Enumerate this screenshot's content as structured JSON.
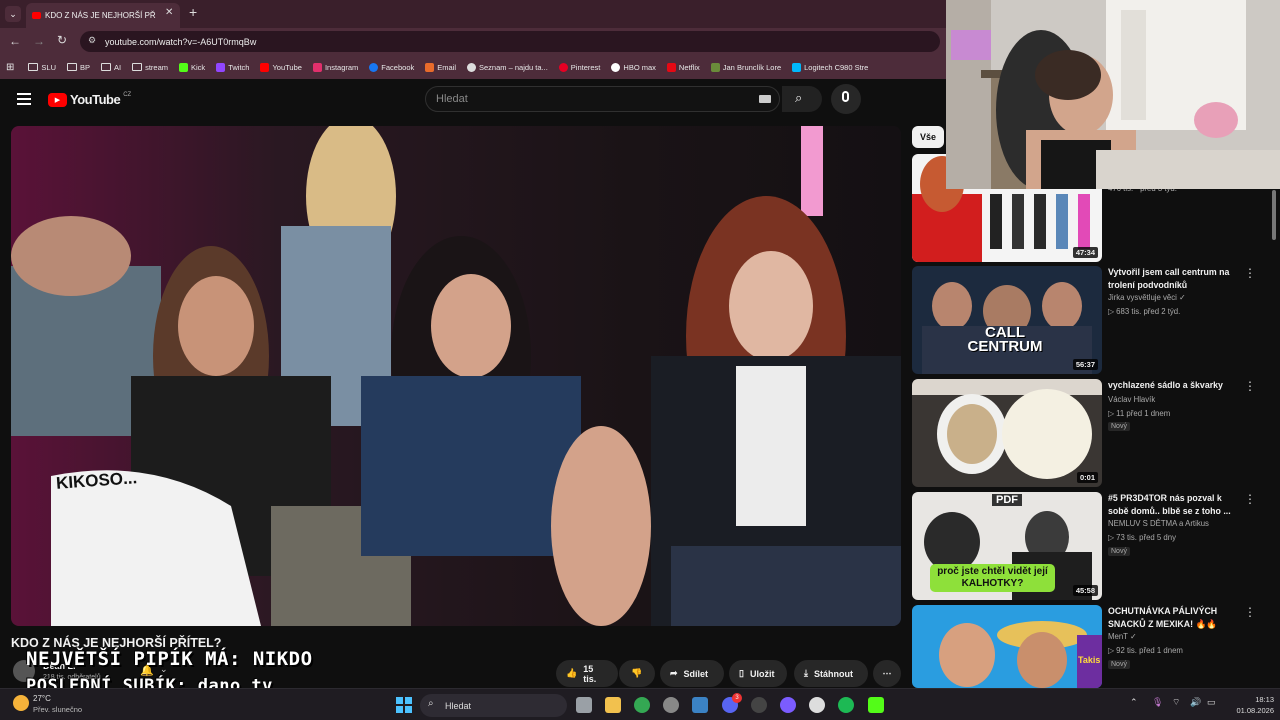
{
  "browser": {
    "tab_title": "KDO Z NÁS JE NEJHORŠÍ PŘ",
    "url": "youtube.com/watch?v=-A6UT0rmqBw",
    "bookmarks": [
      "SLU",
      "BP",
      "AI",
      "stream",
      "Kick",
      "Twitch",
      "YouTube",
      "Instagram",
      "Facebook",
      "Email",
      "Seznam – najdu ta...",
      "Pinterest",
      "HBO max",
      "Netflix",
      "Jan Brunclík Lore",
      "Logitech C980 Stre"
    ]
  },
  "youtube": {
    "logo_text": "YouTube",
    "region": "CZ",
    "search_placeholder": "Hledat",
    "filter_chip": "Vše"
  },
  "video": {
    "title": "KDO Z NÁS JE NEJHORŠÍ PŘÍTEL?",
    "channel": "Dean L.",
    "subscribers": "218 tis. odběratelů",
    "likes": "15 tis.",
    "share_label": "Sdílet",
    "save_label": "Uložit",
    "download_label": "Stáhnout",
    "shirt_text": "KIKOSO..."
  },
  "recommendations": [
    {
      "title": "",
      "channel": "",
      "meta": "476 tis. · před 3 týd.",
      "duration": "47:34",
      "new": ""
    },
    {
      "title": "Vytvořil jsem call centrum na trolení podvodníků",
      "channel": "Jirka vysvětluje věci ✓",
      "meta": "▷ 683 tis.   před 2 týd.",
      "duration": "56:37",
      "new": "",
      "thumb_text": "CALL CENTRUM"
    },
    {
      "title": "vychlazené sádlo a škvarky",
      "channel": "Václav Hlavík",
      "meta": "▷ 11   před 1 dnem",
      "duration": "0:01",
      "new": "Nový"
    },
    {
      "title": "#5 PR3D4TOR nás pozval k sobě domů.. blbě se z toho ...",
      "channel": "NEMLUV S DĚTMA a Artikus",
      "meta": "▷ 73 tis.   před 5 dny",
      "duration": "45:58",
      "new": "Nový",
      "thumb_text": "proč jste chtěl vidět její KALHOTKY?",
      "thumb_tag": "PDF"
    },
    {
      "title": "OCHUTNÁVKA PÁLIVÝCH SNACKŮ Z MEXIKA! 🔥🔥",
      "channel": "MenT ✓",
      "meta": "▷ 92 tis.   před 1 dnem",
      "duration": "",
      "new": "Nový",
      "thumb_text": "Takis"
    }
  ],
  "stream_overlay": {
    "line1": "NEJVĚTŠÍ PIPÍK MÁ: NIKDO",
    "line2": "POSLEDNÍ SUBÍK: dano_tv"
  },
  "taskbar": {
    "weather_temp": "27°C",
    "weather_desc": "Přev. slunečno",
    "search_label": "Hledat",
    "time": "18:13",
    "date": "01.08.2026",
    "badge_count": "3"
  },
  "colors": {
    "chrome_tab": "#3a1f2b",
    "chrome_bar": "#4d2c3a",
    "yt_red": "#ff0000",
    "yt_bg": "#0f0f0f"
  }
}
